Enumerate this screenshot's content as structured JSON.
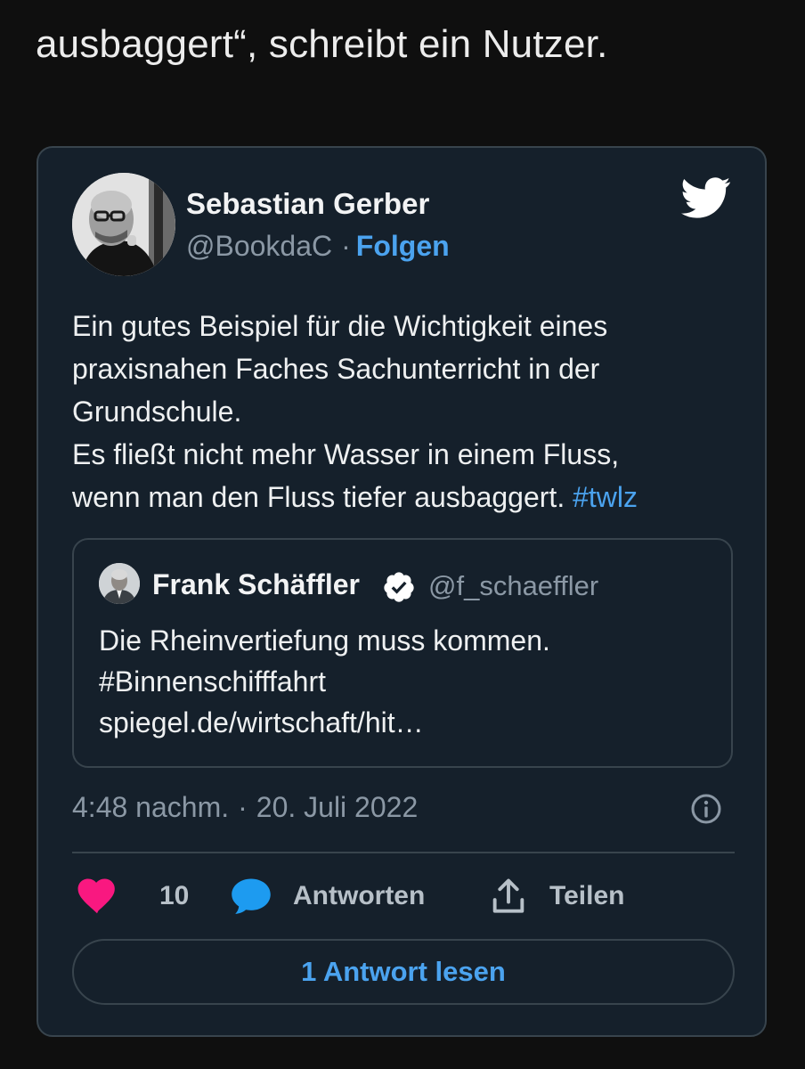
{
  "article": {
    "text": "ausbaggert“, schreibt ein Nutzer."
  },
  "tweet": {
    "author_name": "Sebastian Gerber",
    "handle": "@BookdaC",
    "separator": "·",
    "follow_label": "Folgen",
    "body_lines": [
      "Ein gutes Beispiel für die Wichtigkeit eines",
      "praxisnahen Faches Sachunterricht in der",
      "Grundschule.",
      "Es fließt nicht mehr Wasser in einem Fluss,",
      "wenn man den Fluss tiefer ausbaggert."
    ],
    "hashtag": "#twlz",
    "quote": {
      "author_name": "Frank Schäffler",
      "handle": "@f_schaeffler",
      "body_lines": [
        "Die Rheinvertiefung muss kommen.",
        "#Binnenschifffahrt",
        "spiegel.de/wirtschaft/hit…"
      ]
    },
    "time": "4:48 nachm.",
    "time_separator": "·",
    "date": "20. Juli 2022",
    "actions": {
      "like_count": "10",
      "reply_label": "Antworten",
      "share_label": "Teilen"
    },
    "read_replies_label": "1 Antwort lesen"
  },
  "colors": {
    "background": "#0f0f0f",
    "card": "#15202b",
    "border": "#38444d",
    "accent": "#4ba3ef",
    "like": "#f91880",
    "muted": "#8b98a5"
  },
  "icons": {
    "brand": "twitter-bird-icon",
    "verified": "verified-badge-icon",
    "info": "info-icon",
    "like": "heart-icon",
    "reply": "speech-bubble-icon",
    "share": "share-upload-icon"
  }
}
